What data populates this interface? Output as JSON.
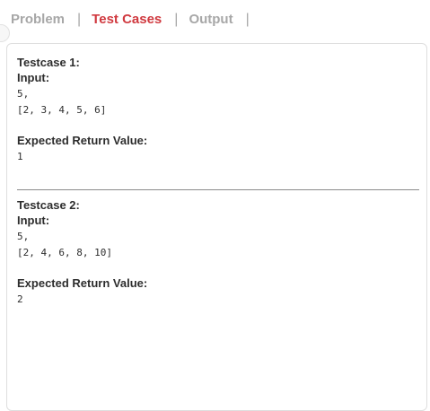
{
  "tabs": [
    {
      "label": "Problem"
    },
    {
      "label": "Test Cases"
    },
    {
      "label": "Output"
    }
  ],
  "separator": "|",
  "testcases": [
    {
      "title": "Testcase 1:",
      "input_label": "Input:",
      "input_lines": [
        "5,",
        "[2, 3, 4, 5, 6]"
      ],
      "expected_label": "Expected Return Value:",
      "expected_value": "1"
    },
    {
      "title": "Testcase 2:",
      "input_label": "Input:",
      "input_lines": [
        "5,",
        "[2, 4, 6, 8, 10]"
      ],
      "expected_label": "Expected Return Value:",
      "expected_value": "2"
    }
  ],
  "colors": {
    "active_tab": "#d0393f",
    "inactive_tab": "#a7a7a7",
    "text": "#2d2d2d"
  }
}
